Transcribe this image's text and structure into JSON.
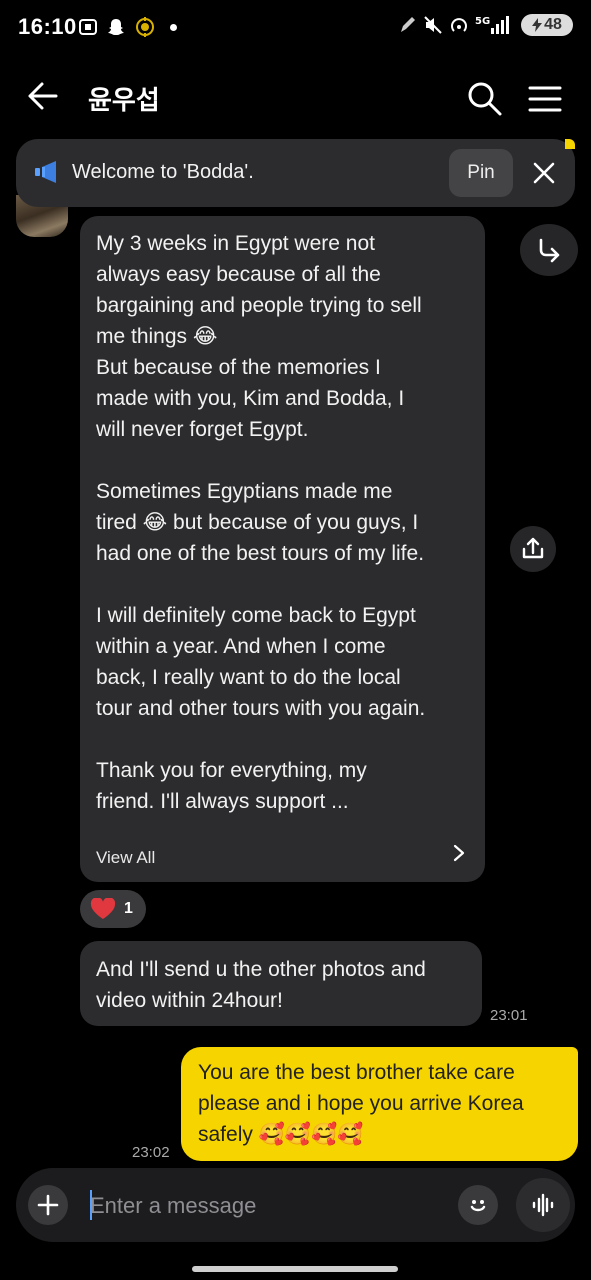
{
  "status_bar": {
    "time": "16:10",
    "battery": "48",
    "icons": [
      "screenshot-icon",
      "snapchat-icon",
      "location-icon",
      "notification-dot",
      "pen-icon",
      "mute-vibrate-icon",
      "hotspot-icon",
      "5g-signal-icon",
      "battery-charging-icon"
    ]
  },
  "header": {
    "title": "윤우섭",
    "back_icon": "back-arrow-icon",
    "search_icon": "search-icon",
    "menu_icon": "menu-icon"
  },
  "notice": {
    "text": "Welcome to 'Bodda'.",
    "pin_label": "Pin",
    "icon": "megaphone-icon"
  },
  "messages": {
    "main": {
      "paragraphs": [
        [
          "My 3 weeks in Egypt were not",
          "always easy because of all the",
          "bargaining and people trying to sell",
          "me things 😂",
          "But because of the memories I",
          "made with you, Kim and Bodda, I",
          "will never forget Egypt."
        ],
        [
          "Sometimes Egyptians made me",
          "tired 😂 but because of you guys, I",
          "had one of the best tours of my life."
        ],
        [
          "I will definitely come back to Egypt",
          "within a year. And when I come",
          "back, I really want to do the local",
          "tour and other tours with you again."
        ],
        [
          "Thank you for everything, my",
          "friend. I'll always support ..."
        ]
      ],
      "view_all": "View All"
    },
    "reaction": {
      "emoji": "heart-icon",
      "count": "1"
    },
    "second": {
      "lines": [
        "And I'll send u the other photos and",
        "video within 24hour!"
      ],
      "time": "23:01"
    },
    "mine": {
      "lines": [
        "You are the best brother take care",
        "please and i hope you arrive Korea",
        "safely 🥰🥰🥰🥰"
      ],
      "time": "23:02"
    }
  },
  "input": {
    "placeholder": "Enter a message"
  },
  "colors": {
    "background": "#000000",
    "bubble_other": "#2c2c2e",
    "bubble_mine": "#f5d400",
    "accent_blue": "#5aa0ff",
    "heart": "#e0383e"
  }
}
